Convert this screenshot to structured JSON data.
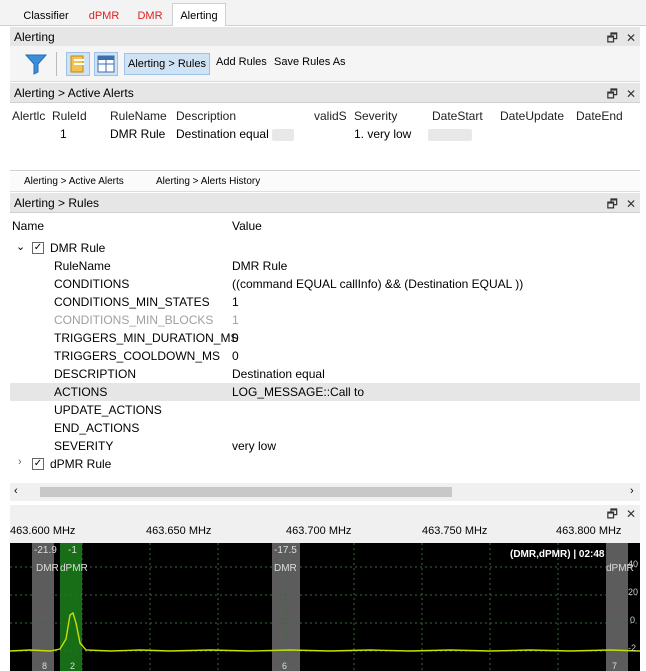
{
  "top_tabs": [
    "Classifier",
    "dPMR",
    "DMR",
    "Alerting"
  ],
  "colors": {
    "tab_red": "#e02020",
    "selected": "#cfe3f5",
    "spectrum_bg": "#000000",
    "grid": "#2a5a2a",
    "signal": "#c8e000",
    "highlight_band": "#b0b0b0",
    "active_band": "#1a7a1a"
  },
  "alerting": {
    "title": "Alerting",
    "toolbar": {
      "rules_label": "Alerting > Rules",
      "add_rules_label": "Add Rules",
      "save_rules_as_label": "Save Rules As"
    }
  },
  "active_alerts": {
    "title": "Alerting > Active Alerts",
    "columns": [
      "Alertlc",
      "RuleId",
      "RuleName",
      "Description",
      "validS",
      "Severity",
      "DateStart",
      "DateUpdate",
      "DateEnd"
    ],
    "row": {
      "ruleid": "1",
      "rulename": "DMR Rule",
      "description": "Destination equal",
      "severity": "1. very low"
    }
  },
  "sub_tabs": [
    "Alerting > Active Alerts",
    "Alerting > Alerts History"
  ],
  "rules": {
    "title": "Alerting > Rules",
    "col_name": "Name",
    "col_value": "Value",
    "rule1": {
      "name": "DMR Rule"
    },
    "rule2": {
      "name": "dPMR Rule"
    },
    "props": [
      {
        "name": "RuleName",
        "value": "DMR Rule"
      },
      {
        "name": "CONDITIONS",
        "value": "((command  EQUAL  callInfo) && (Destination  EQUAL           ))"
      },
      {
        "name": "CONDITIONS_MIN_STATES",
        "value": "1"
      },
      {
        "name": "CONDITIONS_MIN_BLOCKS",
        "value": "1"
      },
      {
        "name": "TRIGGERS_MIN_DURATION_MS",
        "value": "0"
      },
      {
        "name": "TRIGGERS_COOLDOWN_MS",
        "value": "0"
      },
      {
        "name": "DESCRIPTION",
        "value": "Destination equal"
      },
      {
        "name": "ACTIONS",
        "value": "LOG_MESSAGE::Call to"
      },
      {
        "name": "UPDATE_ACTIONS",
        "value": ""
      },
      {
        "name": "END_ACTIONS",
        "value": ""
      },
      {
        "name": "SEVERITY",
        "value": "very low"
      }
    ]
  },
  "spectrum": {
    "freqs": [
      "463.600 MHz",
      "463.650 MHz",
      "463.700 MHz",
      "463.750 MHz",
      "463.800 MHz"
    ],
    "band_labels": [
      "-21.9",
      "-1",
      "-17.5"
    ],
    "band_names": [
      "DMR",
      "dPMR",
      "DMR",
      "dPMR"
    ],
    "status": "(DMR,dPMR) | 02:48",
    "db_ticks": [
      "40",
      "20",
      "0",
      "-2"
    ],
    "channel_numbers": [
      "8",
      "2",
      "6",
      "7"
    ]
  },
  "icons": {
    "filter": "filter-icon",
    "doc": "document-icon",
    "grid": "grid-icon",
    "restore": "restore-icon",
    "close": "close-icon"
  }
}
